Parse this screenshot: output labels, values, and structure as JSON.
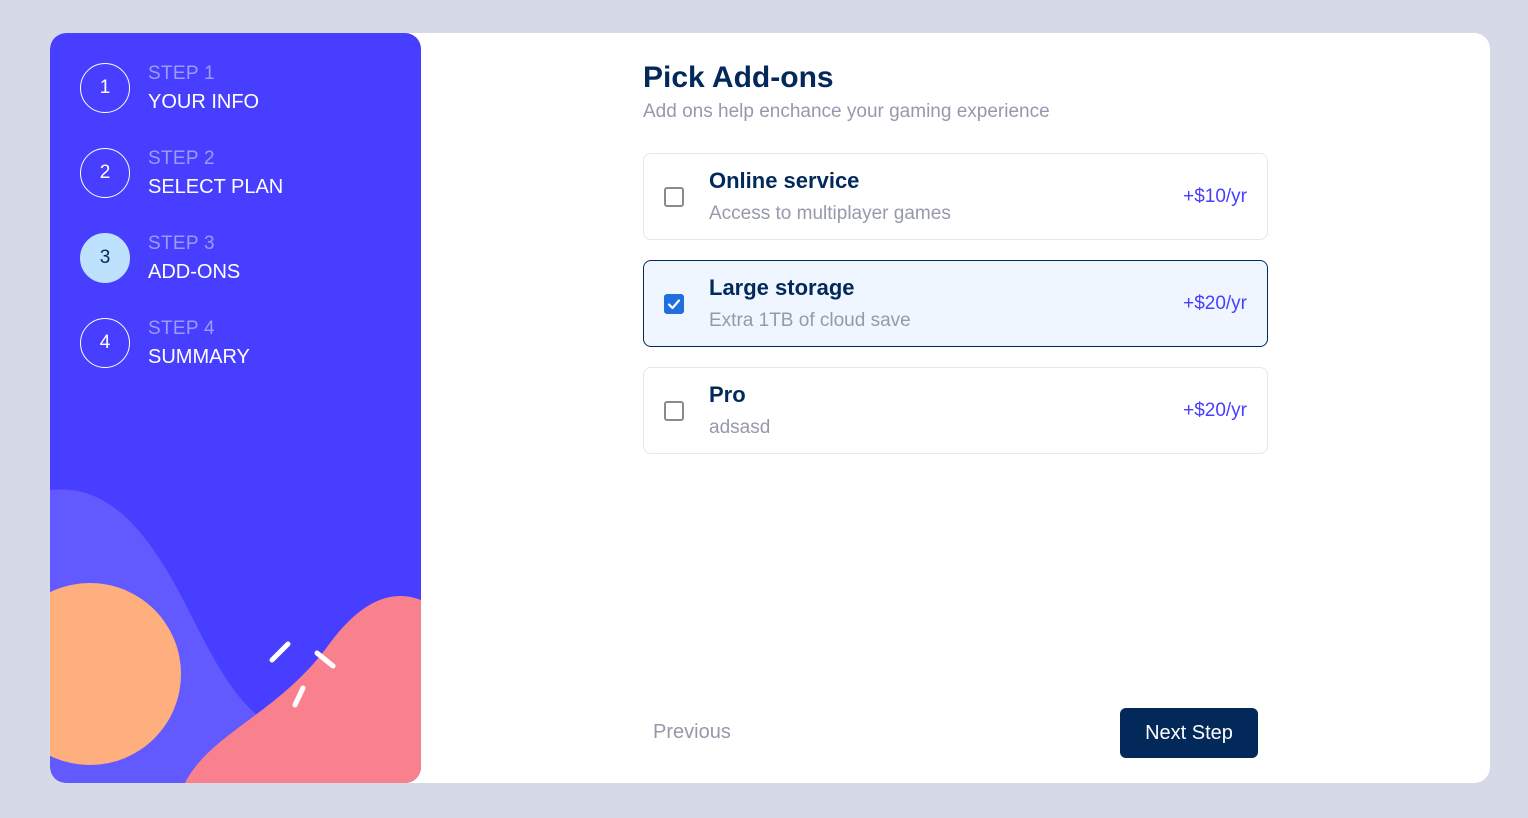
{
  "sidebar": {
    "steps": [
      {
        "number": "1",
        "label": "STEP 1",
        "title": "YOUR INFO",
        "active": false
      },
      {
        "number": "2",
        "label": "STEP 2",
        "title": "SELECT PLAN",
        "active": false
      },
      {
        "number": "3",
        "label": "STEP 3",
        "title": "ADD-ONS",
        "active": true
      },
      {
        "number": "4",
        "label": "STEP 4",
        "title": "SUMMARY",
        "active": false
      }
    ]
  },
  "main": {
    "title": "Pick Add-ons",
    "subtitle": "Add ons help enchance your gaming experience",
    "addons": [
      {
        "name": "Online service",
        "description": "Access to multiplayer games",
        "price": "+$10/yr",
        "checked": false
      },
      {
        "name": "Large storage",
        "description": "Extra 1TB of cloud save",
        "price": "+$20/yr",
        "checked": true
      },
      {
        "name": "Pro",
        "description": "adsasd",
        "price": "+$20/yr",
        "checked": false
      }
    ]
  },
  "footer": {
    "previous_label": "Previous",
    "next_label": "Next Step"
  },
  "colors": {
    "sidebar_bg": "#483eff",
    "active_step": "#bee2fd",
    "primary_dark": "#02295a",
    "accent": "#483eff",
    "checkbox_checked": "#1f6fde"
  }
}
